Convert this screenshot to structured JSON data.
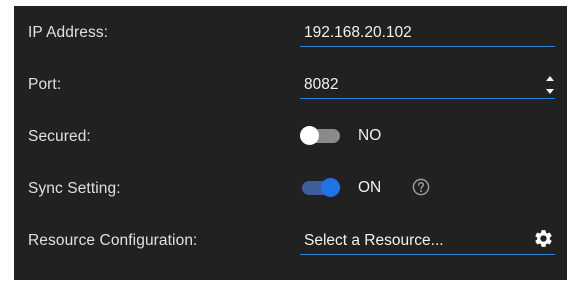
{
  "settings": {
    "ip_address": {
      "label": "IP Address:",
      "value": "192.168.20.102"
    },
    "port": {
      "label": "Port:",
      "value": "8082"
    },
    "secured": {
      "label": "Secured:",
      "state": "NO",
      "enabled": false
    },
    "sync_setting": {
      "label": "Sync Setting:",
      "state": "ON",
      "enabled": true
    },
    "resource_configuration": {
      "label": "Resource Configuration:",
      "placeholder": "Select a Resource..."
    }
  },
  "icons": {
    "help": "help-circle-icon",
    "settings": "gear-icon",
    "spinner_up": "chevron-up-icon",
    "spinner_down": "chevron-down-icon"
  },
  "colors": {
    "panel_background": "#212121",
    "accent": "#1f73e8",
    "underline": "#2f7fd6",
    "toggle_on_track": "#3d5d9d",
    "toggle_off_track": "#8a8a8a",
    "text": "#e0e0e0"
  }
}
